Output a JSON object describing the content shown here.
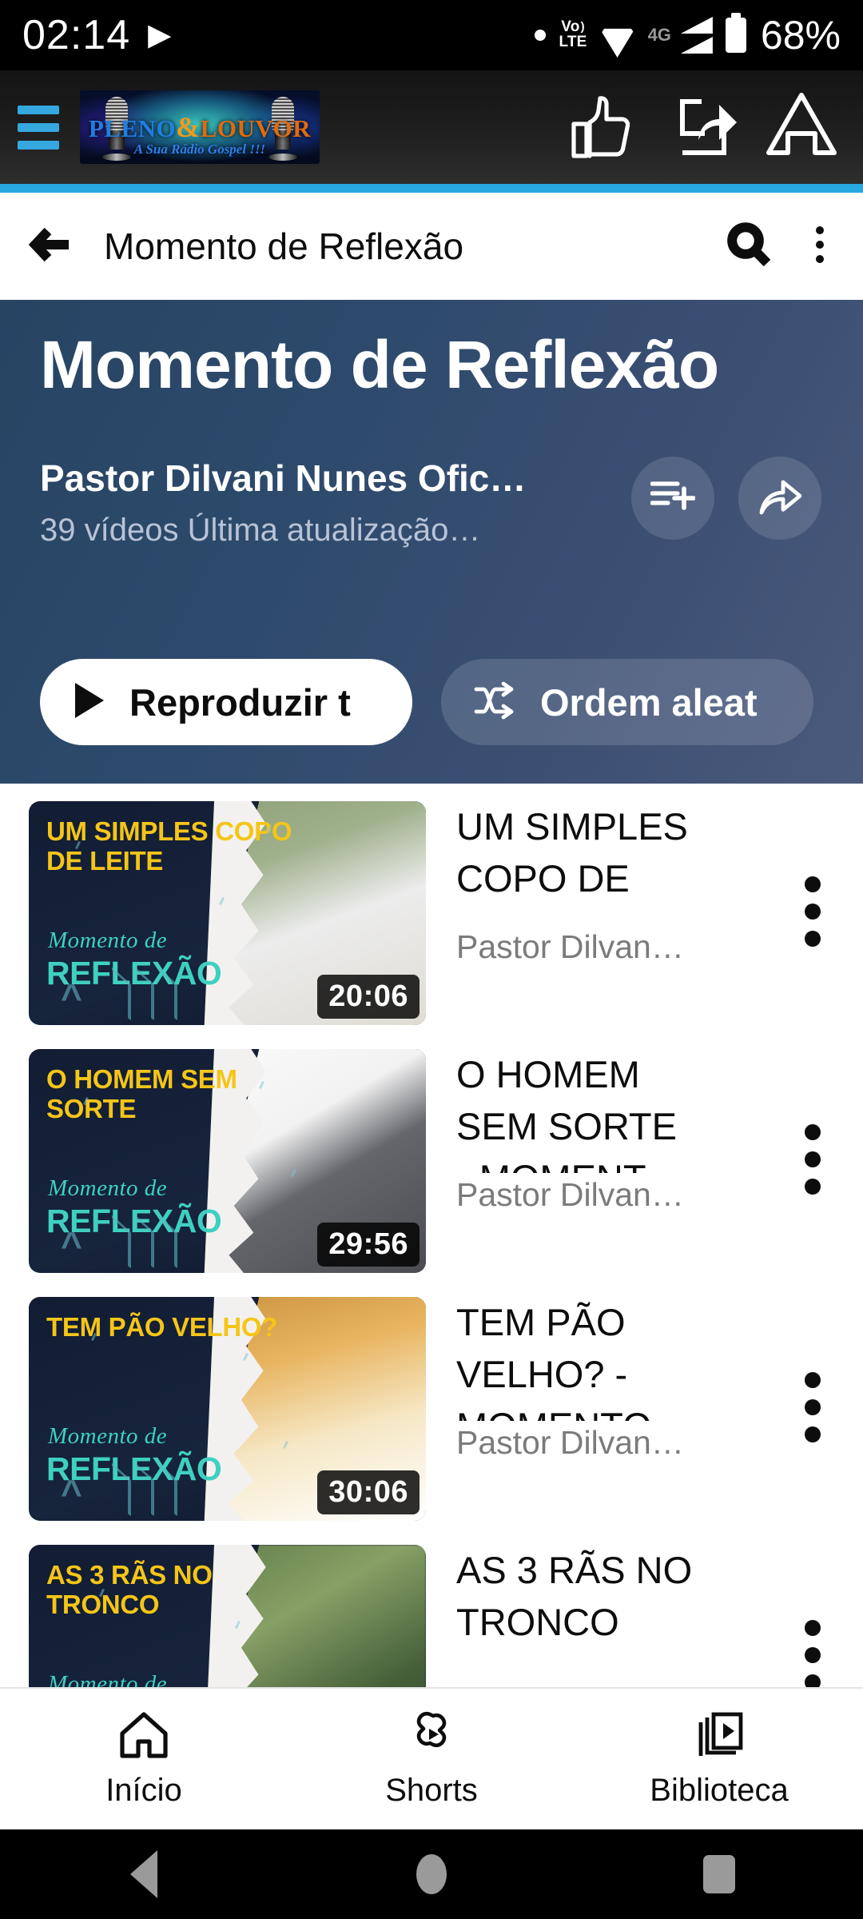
{
  "status_bar": {
    "time": "02:14",
    "play_icon": "play-icon",
    "dot_icon": "dot-icon",
    "volte_top": "Vo",
    "volte_bottom": "LTE",
    "wifi_icon": "wifi-icon",
    "network_type": "4G",
    "signal_icon": "signal-bars-icon",
    "battery_icon": "battery-icon",
    "battery_percent": "68%"
  },
  "app_bar": {
    "menu_icon": "hamburger-menu-icon",
    "logo": {
      "name_part1": "PLENO",
      "ampersand": "&",
      "name_part2": "LOUVOR",
      "tagline": "A Sua Rádio Gospel !!!"
    },
    "like_icon": "thumbs-up-icon",
    "share_icon": "share-icon",
    "home_icon": "home-icon",
    "accent_color": "#29a8e0"
  },
  "toolbar": {
    "back_icon": "back-arrow-icon",
    "title": "Momento de Reflexão",
    "search_icon": "search-icon",
    "overflow_icon": "more-vertical-icon"
  },
  "playlist_header": {
    "title": "Momento de Reflexão",
    "channel": "Pastor Dilvani Nunes Ofic…",
    "meta": "39 vídeos  Última atualização…",
    "video_count": "39 vídeos",
    "last_update": "Última atualização…",
    "save_icon": "save-to-playlist-icon",
    "share_icon": "share-arrow-icon",
    "play_all": {
      "label": "Reproduzir t",
      "icon": "play-icon"
    },
    "shuffle": {
      "label": "Ordem aleat",
      "icon": "shuffle-icon"
    },
    "gradient_from": "#274463",
    "gradient_to": "#4a5a7c"
  },
  "videos": [
    {
      "title": "UM SIMPLES COPO DE",
      "channel": "Pastor Dilvan…",
      "duration": "20:06",
      "thumb_title": "UM SIMPLES COPO DE LEITE",
      "thumb_script": "Momento de",
      "thumb_brand": "REFLEXÃO",
      "menu_icon": "more-vertical-icon",
      "photo_colors": [
        "#7f8f6a",
        "#e8e6df",
        "#f7f5ee"
      ]
    },
    {
      "title": "O HOMEM SEM SORTE - MOMENT",
      "channel": "Pastor Dilvan…",
      "duration": "29:56",
      "thumb_title": "O HOMEM SEM SORTE",
      "thumb_script": "Momento de",
      "thumb_brand": "REFLEXÃO",
      "menu_icon": "more-vertical-icon",
      "photo_colors": [
        "#f4f4f4",
        "#5b5d62",
        "#3f4146"
      ]
    },
    {
      "title": "TEM PÃO VELHO? - MOMENTO",
      "channel": "Pastor Dilvan…",
      "duration": "30:06",
      "thumb_title": "TEM PÃO VELHO?",
      "thumb_script": "Momento de",
      "thumb_brand": "REFLEXÃO",
      "menu_icon": "more-vertical-icon",
      "photo_colors": [
        "#d79b4b",
        "#f3e4c4",
        "#ffffff"
      ]
    },
    {
      "title": "AS 3 RÃS NO TRONCO",
      "channel": "",
      "duration": "",
      "thumb_title": "AS 3 RÃS NO TRONCO",
      "thumb_script": "Momento de",
      "thumb_brand": "",
      "menu_icon": "more-vertical-icon",
      "photo_colors": [
        "#4e6b3c",
        "#77945c",
        "#3a5230"
      ]
    }
  ],
  "bottom_nav": [
    {
      "label": "Início",
      "icon": "home-icon"
    },
    {
      "label": "Shorts",
      "icon": "shorts-icon"
    },
    {
      "label": "Biblioteca",
      "icon": "library-icon"
    }
  ],
  "android_nav": {
    "back": "back-triangle-icon",
    "home": "home-circle-icon",
    "recents": "recents-square-icon"
  }
}
